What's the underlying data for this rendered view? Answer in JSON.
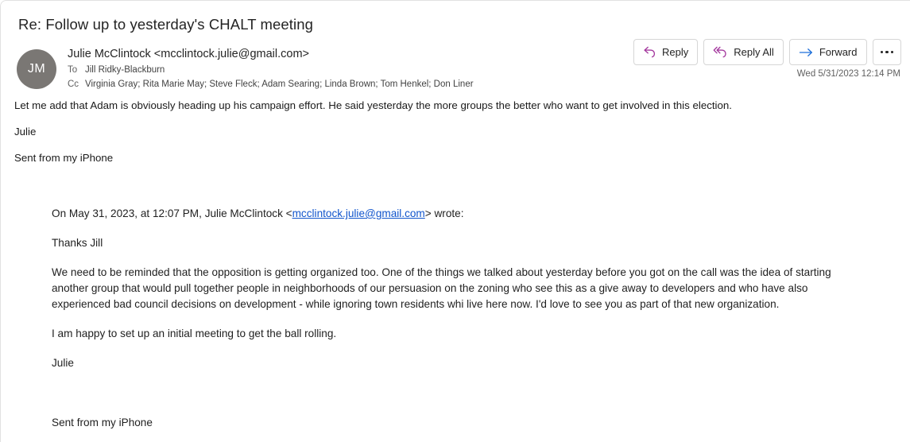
{
  "message": {
    "subject": "Re: Follow up to yesterday's CHALT meeting",
    "avatar_initials": "JM",
    "sender_line": "Julie McClintock <mcclintock.julie@gmail.com>",
    "to_label": "To",
    "to_names": "Jill Ridky-Blackburn",
    "cc_label": "Cc",
    "cc_names": "Virginia Gray; Rita Marie May; Steve Fleck; Adam Searing; Linda Brown; Tom Henkel; Don Liner",
    "timestamp": "Wed 5/31/2023 12:14 PM"
  },
  "actions": {
    "reply_label": "Reply",
    "reply_all_label": "Reply All",
    "forward_label": "Forward",
    "more_label": "",
    "reply_icon_color": "#A4399E",
    "forward_icon_color": "#1E6FD9"
  },
  "body": {
    "paragraph_1": "Let me add that Adam is obviously heading up his campaign effort. He said yesterday the more groups the better who want to get involved in this election.",
    "signoff": "Julie",
    "sent_from": "Sent from my iPhone"
  },
  "quoted": {
    "intro_prefix": "On May 31, 2023, at 12:07 PM, Julie McClintock <",
    "intro_link": "mcclintock.julie@gmail.com",
    "intro_suffix": "> wrote:",
    "greeting": "Thanks Jill",
    "paragraph_1": "We need to be reminded that the opposition is getting organized too. One of the things we talked about yesterday before you got on the call was the idea of starting another group that would pull together people in neighborhoods of our persuasion on the zoning who see this as a give away to developers and who have also experienced bad council decisions on development - while ignoring town residents whi live here now.  I'd love to see you as part of that new organization.",
    "paragraph_2": "I am happy to set up an initial meeting to get the ball rolling.",
    "signoff": "Julie",
    "sent_from": "Sent from my iPhone"
  }
}
